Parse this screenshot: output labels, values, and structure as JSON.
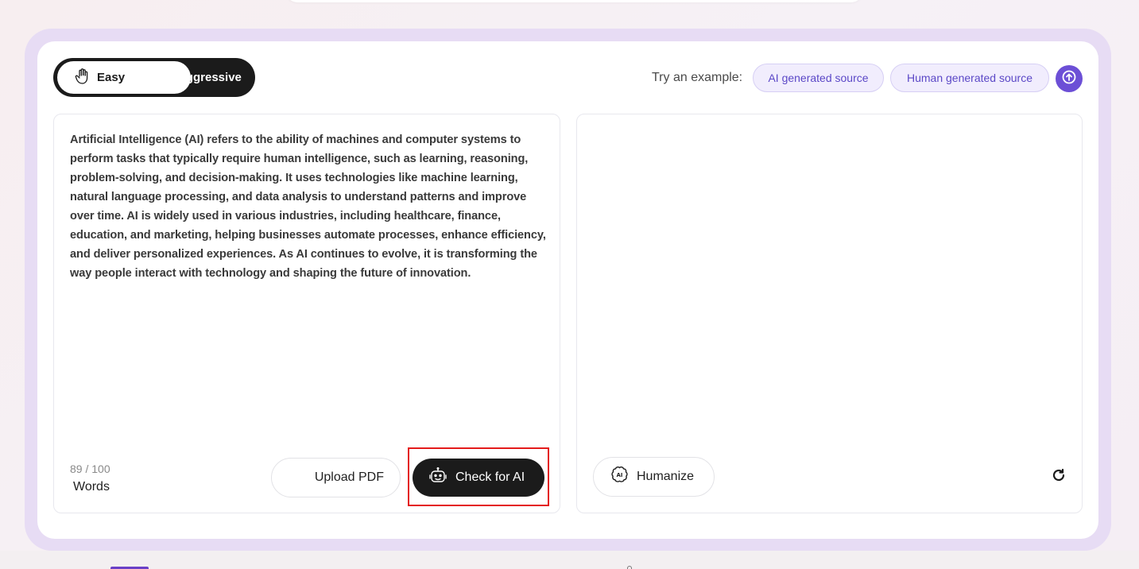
{
  "mode_toggle": {
    "easy_label": "Easy",
    "aggressive_label": "Aggressive",
    "selected": "Easy",
    "easy_icon": "hand-icon",
    "aggressive_icon": "text-scan-icon"
  },
  "examples": {
    "label": "Try an example:",
    "ai_source": "AI generated source",
    "human_source": "Human generated source",
    "extra_icon": "upload-circle-icon"
  },
  "input": {
    "text": "Artificial Intelligence (AI) refers to the ability of machines and computer systems to perform tasks that typically require human intelligence, such as learning, reasoning, problem-solving, and decision-making. It uses technologies like machine learning, natural language processing, and data analysis to understand patterns and improve over time. AI is widely used in various industries, including healthcare, finance, education, and marketing, helping businesses automate processes, enhance efficiency, and deliver personalized experiences. As AI continues to evolve, it is transforming the way people interact with technology and shaping the future of innovation.",
    "word_count": "89 / 100",
    "word_label": "Words"
  },
  "actions": {
    "upload_pdf": "Upload PDF",
    "check_ai": "Check for AI",
    "check_ai_icon": "robot-icon"
  },
  "output": {
    "humanize": "Humanize",
    "humanize_icon": "brain-ai-icon",
    "refresh_icon": "refresh-icon"
  },
  "colors": {
    "accent": "#6c4fd6",
    "pill_bg": "#f1edfd",
    "pill_text": "#5b48c7",
    "dark_button": "#1b1b1b",
    "highlight": "#e41b1b"
  }
}
